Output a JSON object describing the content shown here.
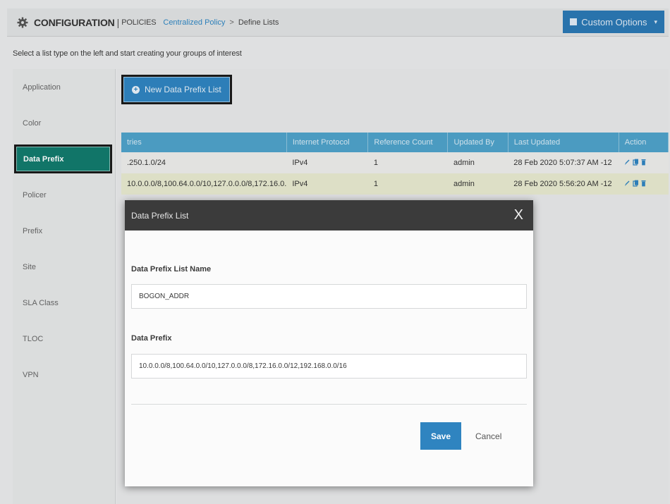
{
  "header": {
    "title": "CONFIGURATION",
    "separator": "|",
    "section": "POLICIES",
    "breadcrumb_link": "Centralized Policy",
    "breadcrumb_arrow": ">",
    "breadcrumb_current": "Define Lists",
    "custom_options_label": "Custom Options",
    "custom_options_caret": "▾"
  },
  "hint": "Select a list type on the left and start creating your groups of interest",
  "sidebar": {
    "items": [
      {
        "label": "Application"
      },
      {
        "label": "Color"
      },
      {
        "label": "Data Prefix",
        "active": true
      },
      {
        "label": "Policer"
      },
      {
        "label": "Prefix"
      },
      {
        "label": "Site"
      },
      {
        "label": "SLA Class"
      },
      {
        "label": "TLOC"
      },
      {
        "label": "VPN"
      }
    ]
  },
  "new_button_label": "New Data Prefix List",
  "table": {
    "columns": [
      "tries",
      "Internet Protocol",
      "Reference Count",
      "Updated By",
      "Last Updated",
      "Action"
    ],
    "rows": [
      {
        "entries": ".250.1.0/24",
        "protocol": "IPv4",
        "ref_count": "1",
        "updated_by": "admin",
        "last_updated": "28 Feb 2020 5:07:37 AM -12"
      },
      {
        "entries": "10.0.0.0/8,100.64.0.0/10,127.0.0.0/8,172.16.0.",
        "protocol": "IPv4",
        "ref_count": "1",
        "updated_by": "admin",
        "last_updated": "28 Feb 2020 5:56:20 AM -12"
      }
    ]
  },
  "modal": {
    "title": "Data Prefix List",
    "close": "X",
    "name_label": "Data Prefix List Name",
    "name_value": "BOGON_ADDR",
    "prefix_label": "Data Prefix",
    "prefix_value": "10.0.0.0/8,100.64.0.0/10,127.0.0.0/8,172.16.0.0/12,192.168.0.0/16",
    "save_label": "Save",
    "cancel_label": "Cancel"
  },
  "colors": {
    "accent": "#2f84c0",
    "active_sidebar": "#127a6d",
    "table_header": "#4fa2c9",
    "modal_header": "#3b3b3b"
  },
  "icons": {
    "header": "gear-icon",
    "custom_options": "square-icon",
    "new_button": "plus-circle-icon",
    "row_actions": [
      "edit-icon",
      "copy-icon",
      "delete-icon"
    ]
  }
}
